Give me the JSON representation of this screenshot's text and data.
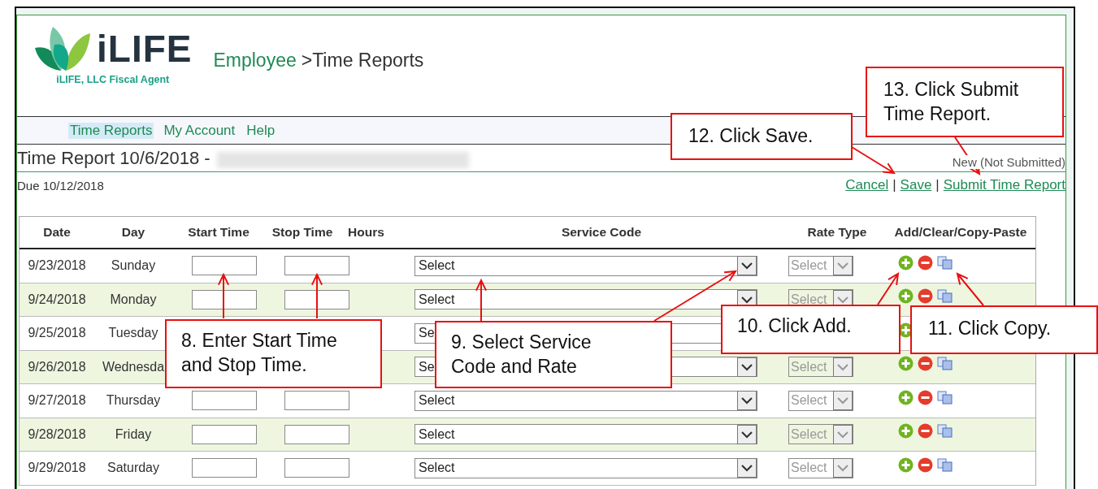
{
  "header": {
    "logo_text": "iLIFE",
    "logo_tagline": "iLIFE, LLC Fiscal Agent",
    "breadcrumb_link": "Employee",
    "breadcrumb_current": ">Time Reports"
  },
  "nav": [
    {
      "label": "Time Reports",
      "selected": true
    },
    {
      "label": "My Account",
      "selected": false
    },
    {
      "label": "Help",
      "selected": false
    }
  ],
  "report": {
    "title": "Time Report 10/6/2018 -",
    "status": "New (Not Submitted)",
    "due": "Due 10/12/2018",
    "actions": [
      "Cancel",
      "Save",
      "Submit Time Report"
    ],
    "separators": [
      "|",
      "|"
    ]
  },
  "table": {
    "columns": [
      "Date",
      "Day",
      "Start Time",
      "Stop Time",
      "Hours",
      "Service Code",
      "Rate Type",
      "Add/Clear/Copy-Paste"
    ],
    "rows": [
      {
        "date": "9/23/2018",
        "day": "Sunday",
        "inputs": [
          {
            "kind": "start"
          },
          {
            "kind": "stop"
          }
        ],
        "service": "Select",
        "rate": "Select"
      },
      {
        "date": "9/24/2018",
        "day": "Monday",
        "inputs": [
          {
            "kind": "start"
          },
          {
            "kind": "stop"
          }
        ],
        "service": "Select",
        "rate": "Select"
      },
      {
        "date": "9/25/2018",
        "day": "Tuesday",
        "service": "Se"
      },
      {
        "date": "9/26/2018",
        "day": "Wednesda",
        "service": "Se",
        "rate": "Select"
      },
      {
        "date": "9/27/2018",
        "day": "Thursday",
        "inputs": [
          {
            "kind": "start"
          },
          {
            "kind": "stop"
          }
        ],
        "service": "Select",
        "rate": "Select"
      },
      {
        "date": "9/28/2018",
        "day": "Friday",
        "inputs": [
          {
            "kind": "start"
          },
          {
            "kind": "stop"
          }
        ],
        "service": "Select",
        "rate": "Select"
      },
      {
        "date": "9/29/2018",
        "day": "Saturday",
        "inputs": [
          {
            "kind": "start"
          },
          {
            "kind": "stop"
          }
        ],
        "service": "Select",
        "rate": "Select"
      }
    ]
  },
  "callouts": [
    {
      "text": "8. Enter Start Time and Stop Time."
    },
    {
      "text": "9. Select Service Code and Rate"
    },
    {
      "text": "10. Click Add."
    },
    {
      "text": "11. Click Copy."
    },
    {
      "text": "12. Click Save."
    },
    {
      "text": "13. Click Submit Time Report."
    }
  ]
}
